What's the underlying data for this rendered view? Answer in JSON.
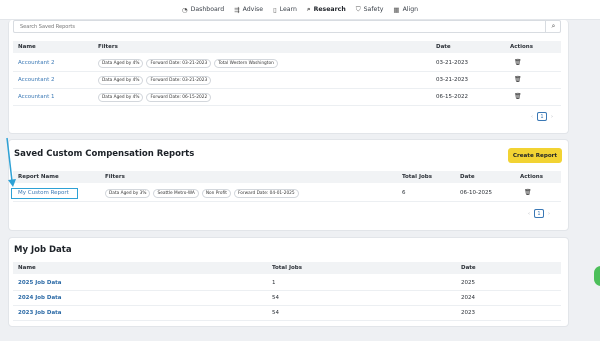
{
  "nav": {
    "items": [
      {
        "label": "Dashboard",
        "icon": "dashboard-icon",
        "glyph": "◔"
      },
      {
        "label": "Advise",
        "icon": "advise-icon",
        "glyph": "⇶"
      },
      {
        "label": "Learn",
        "icon": "book-icon",
        "glyph": "▯"
      },
      {
        "label": "Research",
        "icon": "microscope-icon",
        "glyph": "⌕"
      },
      {
        "label": "Safety",
        "icon": "shield-icon",
        "glyph": "⛉"
      },
      {
        "label": "Align",
        "icon": "grid-icon",
        "glyph": "▦"
      }
    ],
    "active": "Research"
  },
  "saved_reports": {
    "search_placeholder": "Search Saved Reports",
    "columns": {
      "name": "Name",
      "filters": "Filters",
      "date": "Date",
      "actions": "Actions"
    },
    "rows": [
      {
        "name": "Accountant 2",
        "filters": [
          "Data Aged by 4%",
          "Forward Date: 03-21-2023",
          "Total Western Washington"
        ],
        "date": "03-21-2023"
      },
      {
        "name": "Accountant 2",
        "filters": [
          "Data Aged by 4%",
          "Forward Date: 03-21-2023"
        ],
        "date": "03-21-2023"
      },
      {
        "name": "Accountant 1",
        "filters": [
          "Data Aged by 4%",
          "Forward Date: 06-15-2022"
        ],
        "date": "06-15-2022"
      }
    ],
    "page": "1"
  },
  "custom_reports": {
    "title": "Saved Custom Compensation Reports",
    "create_label": "Create Report",
    "columns": {
      "name": "Report Name",
      "filters": "Filters",
      "total_jobs": "Total Jobs",
      "date": "Date",
      "actions": "Actions"
    },
    "rows": [
      {
        "name": "My Custom Report",
        "filters": [
          "Data Aged by 3%",
          "Seattle Metro-WA",
          "Non Profit",
          "Forward Date: 04-01-2025"
        ],
        "total_jobs": "6",
        "date": "06-10-2025"
      }
    ],
    "page": "1"
  },
  "job_data": {
    "title": "My Job Data",
    "columns": {
      "name": "Name",
      "total_jobs": "Total Jobs",
      "date": "Date"
    },
    "rows": [
      {
        "name": "2025 Job Data",
        "total_jobs": "1",
        "date": "2025"
      },
      {
        "name": "2024 Job Data",
        "total_jobs": "54",
        "date": "2024"
      },
      {
        "name": "2023 Job Data",
        "total_jobs": "54",
        "date": "2023"
      }
    ]
  },
  "colors": {
    "accent": "#3a78b5",
    "create_button": "#f2d333",
    "annotation": "#2ea1d5"
  }
}
